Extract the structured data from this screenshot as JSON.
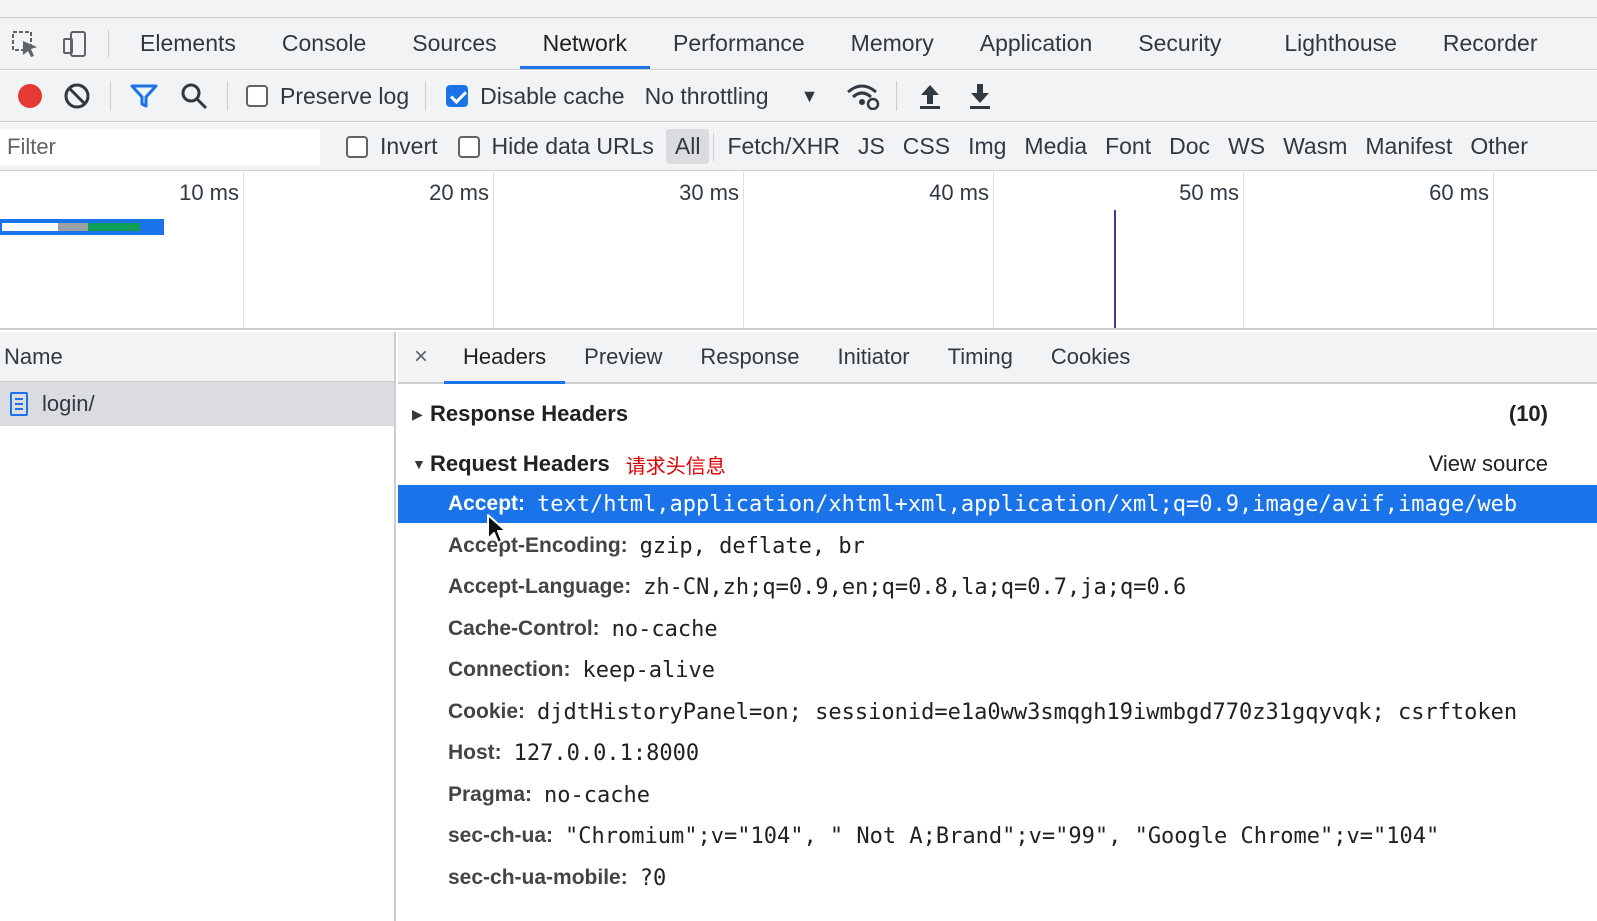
{
  "panel_tabs": [
    "Elements",
    "Console",
    "Sources",
    "Network",
    "Performance",
    "Memory",
    "Application",
    "Security",
    "Lighthouse",
    "Recorder"
  ],
  "active_panel_tab": "Network",
  "toolbar": {
    "preserve_log_label": "Preserve log",
    "preserve_log_checked": false,
    "disable_cache_label": "Disable cache",
    "disable_cache_checked": true,
    "throttling_value": "No throttling"
  },
  "filter": {
    "placeholder": "Filter",
    "invert_label": "Invert",
    "hide_data_urls_label": "Hide data URLs",
    "types": [
      "All",
      "Fetch/XHR",
      "JS",
      "CSS",
      "Img",
      "Media",
      "Font",
      "Doc",
      "WS",
      "Wasm",
      "Manifest",
      "Other"
    ],
    "active_type": "All"
  },
  "timeline": {
    "ticks": [
      "10 ms",
      "20 ms",
      "30 ms",
      "40 ms",
      "50 ms",
      "60 ms"
    ],
    "colors": {
      "waiting": "#1a73e8",
      "download": "#0f9d58",
      "stalled": "#9aa0a6",
      "marker": "#3c3c9c"
    }
  },
  "requests": {
    "header": "Name",
    "items": [
      {
        "name": "login/"
      }
    ]
  },
  "details": {
    "close": "×",
    "tabs": [
      "Headers",
      "Preview",
      "Response",
      "Initiator",
      "Timing",
      "Cookies"
    ],
    "active_tab": "Headers",
    "response_headers": {
      "title": "Response Headers",
      "count": "(10)"
    },
    "request_headers": {
      "title": "Request Headers",
      "annotation": "请求头信息",
      "view_source": "View source",
      "rows": [
        {
          "name": "Accept:",
          "value": "text/html,application/xhtml+xml,application/xml;q=0.9,image/avif,image/web",
          "selected": true
        },
        {
          "name": "Accept-Encoding:",
          "value": "gzip, deflate, br"
        },
        {
          "name": "Accept-Language:",
          "value": "zh-CN,zh;q=0.9,en;q=0.8,la;q=0.7,ja;q=0.6"
        },
        {
          "name": "Cache-Control:",
          "value": "no-cache"
        },
        {
          "name": "Connection:",
          "value": "keep-alive"
        },
        {
          "name": "Cookie:",
          "value": "djdtHistoryPanel=on; sessionid=e1a0ww3smqgh19iwmbgd770z31gqyvqk; csrftoken"
        },
        {
          "name": "Host:",
          "value": "127.0.0.1:8000"
        },
        {
          "name": "Pragma:",
          "value": "no-cache"
        },
        {
          "name": "sec-ch-ua:",
          "value": "\"Chromium\";v=\"104\", \" Not A;Brand\";v=\"99\", \"Google Chrome\";v=\"104\""
        },
        {
          "name": "sec-ch-ua-mobile:",
          "value": "?0"
        }
      ]
    }
  },
  "colors": {
    "accent": "#1a73e8",
    "record": "#e53935",
    "annotation": "#e00000"
  }
}
